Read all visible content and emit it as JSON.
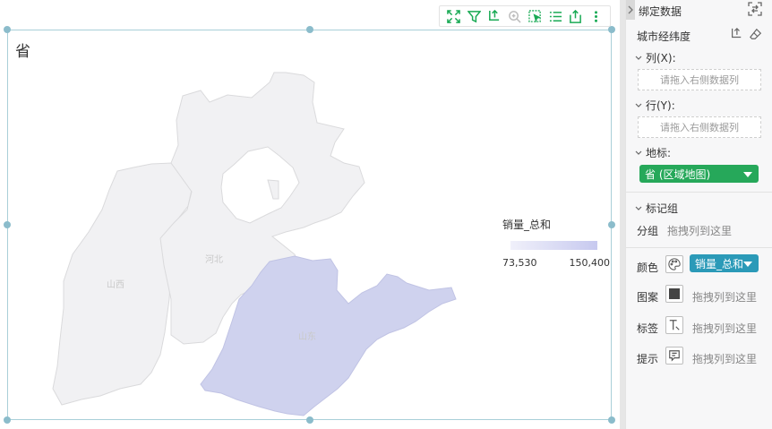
{
  "map": {
    "title": "省",
    "provinces": [
      {
        "name": "山西",
        "fill": "#f1f1f3"
      },
      {
        "name": "河北",
        "fill": "#f1f1f3"
      },
      {
        "name": "山东",
        "fill": "#cfd2ee"
      }
    ],
    "legend": {
      "title": "销量_总和",
      "min": "73,530",
      "max": "150,400",
      "color_low": "#f0f0fa",
      "color_high": "#c7c9ef"
    }
  },
  "toolbar": {
    "icons": [
      "fullscreen-icon",
      "filter-icon",
      "drill-icon",
      "zoom-icon",
      "select-icon",
      "list-icon",
      "export-icon",
      "more-icon"
    ],
    "color": "#1aaa55"
  },
  "panel": {
    "title": "绑定数据",
    "geo_label": "城市经纬度",
    "columns": {
      "label": "列(X):",
      "placeholder": "请拖入右侧数据列"
    },
    "rows": {
      "label": "行(Y):",
      "placeholder": "请拖入右侧数据列"
    },
    "landmark": {
      "label": "地标:",
      "value": "省 (区域地图)",
      "color": "#26a85a"
    },
    "marks": {
      "label": "标记组",
      "group_label": "分组",
      "group_drop": "拖拽列到这里",
      "color_label": "颜色",
      "color_value": "销量_总和",
      "color_pill": "#2b9ab8",
      "pattern_label": "图案",
      "pattern_drop": "拖拽列到这里",
      "tag_label": "标签",
      "tag_drop": "拖拽列到这里",
      "tip_label": "提示",
      "tip_drop": "拖拽列到这里"
    }
  }
}
